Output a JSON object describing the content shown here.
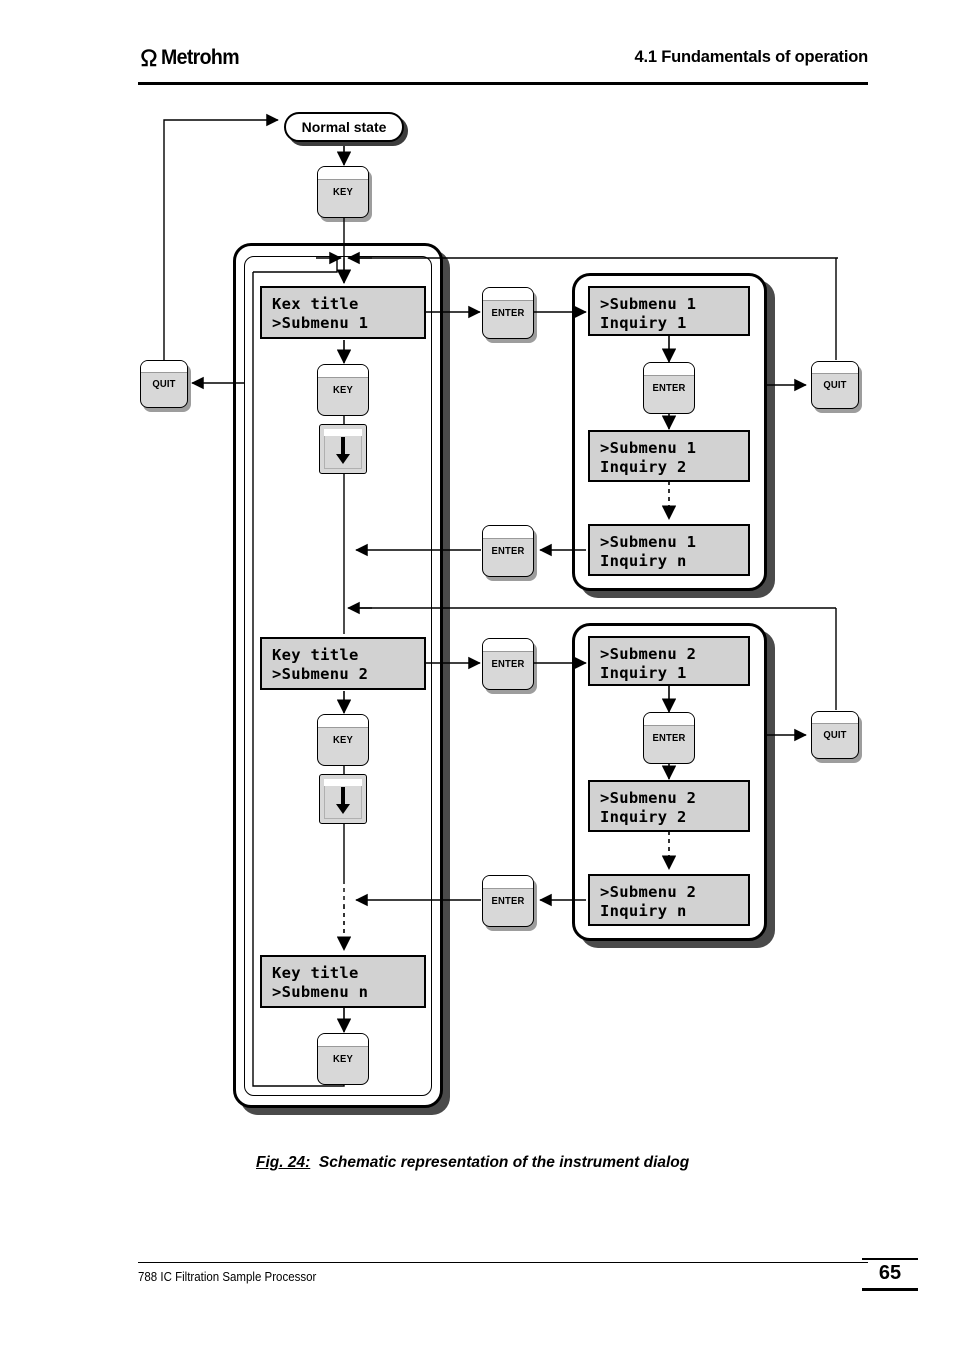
{
  "header": {
    "logo_text": "Metrohm",
    "logo_icon": "metrohm-omega-icon",
    "section_title": "4.1  Fundamentals of operation"
  },
  "footer": {
    "doc_title": "788 IC Filtration Sample Processor",
    "page_number": "65"
  },
  "caption": {
    "figure_label": "Fig. 24:",
    "figure_text": "Schematic representation of the instrument dialog"
  },
  "diagram": {
    "normal_state_label": "Normal state",
    "buttons": {
      "key": "KEY",
      "enter": "ENTER",
      "quit": "QUIT",
      "arrow_down": "↓"
    },
    "main_menu_screens": [
      {
        "line1": "Kex title",
        "line2": ">Submenu 1"
      },
      {
        "line1": "Key title",
        "line2": ">Submenu 2"
      },
      {
        "line1": "Key title",
        "line2": ">Submenu n"
      }
    ],
    "submenu_panels": [
      {
        "screens": [
          {
            "line1": ">Submenu 1",
            "line2": "Inquiry 1"
          },
          {
            "line1": ">Submenu 1",
            "line2": "Inquiry 2"
          },
          {
            "line1": ">Submenu 1",
            "line2": "Inquiry n"
          }
        ]
      },
      {
        "screens": [
          {
            "line1": ">Submenu 2",
            "line2": "Inquiry 1"
          },
          {
            "line1": ">Submenu 2",
            "line2": "Inquiry 2"
          },
          {
            "line1": ">Submenu 2",
            "line2": "Inquiry n"
          }
        ]
      }
    ],
    "colors": {
      "lcd_background": "#d2d2d2",
      "button_face": "#d8d8d8",
      "panel_shadow": "#4a4a4a",
      "line": "#000000"
    }
  }
}
